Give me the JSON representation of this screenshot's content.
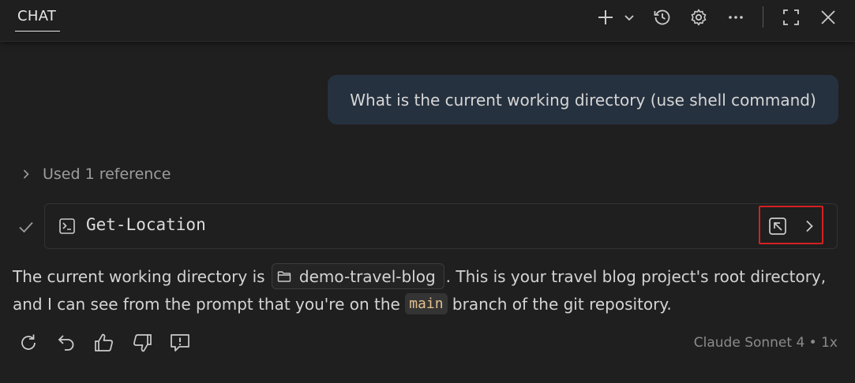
{
  "header": {
    "tab_label": "CHAT",
    "icons": [
      "add-icon",
      "chevron-down-icon",
      "history-icon",
      "gear-icon",
      "more-icon",
      "maximize-icon",
      "close-icon"
    ]
  },
  "faded_text": "",
  "user_message": "What is the current working directory (use shell command)",
  "references": {
    "label": "Used 1 reference"
  },
  "tool_call": {
    "command": "Get-Location",
    "status": "completed"
  },
  "response": {
    "part1": "The current working directory is",
    "folder_name": "demo-travel-blog",
    "part2": ". This is your travel blog project's root directory, and I can see from the prompt that you're on the",
    "branch": "main",
    "part3": "branch of the git repository."
  },
  "model_info": "Claude Sonnet 4 • 1x",
  "colors": {
    "background": "#1f1f1f",
    "user_bubble": "#26313f",
    "highlight": "#d42121",
    "code_text": "#e2c08d"
  }
}
